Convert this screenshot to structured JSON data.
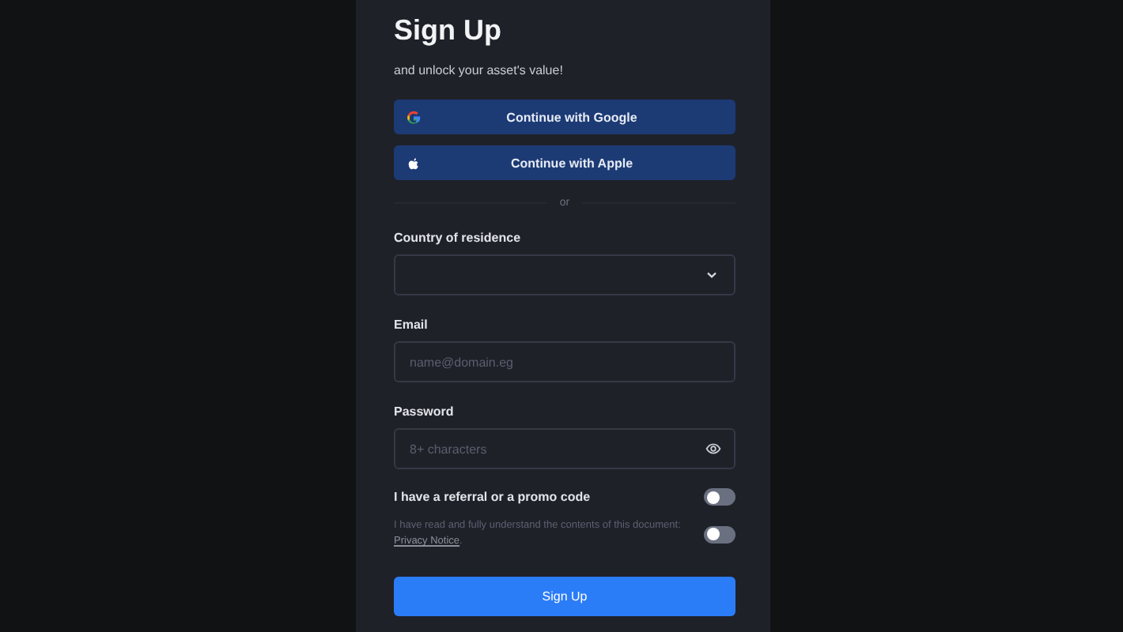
{
  "title": "Sign Up",
  "subtitle": "and unlock your asset's value!",
  "social_buttons": [
    {
      "kind": "google",
      "label": "Continue with Google"
    },
    {
      "kind": "apple",
      "label": "Continue with Apple"
    }
  ],
  "divider": "or",
  "fields": [
    {
      "kind": "select",
      "label": "Country of residence"
    },
    {
      "kind": "email",
      "label": "Email",
      "placeholder": "name@domain.eg"
    },
    {
      "kind": "password",
      "label": "Password",
      "placeholder": "8+ characters"
    }
  ],
  "toggles": [
    {
      "kind": "promo",
      "label": "I have a referral or a promo code",
      "on": false
    },
    {
      "kind": "consent",
      "label": "I have read and fully understand the contents of this document:",
      "link": "Privacy Notice",
      "suffix": ".",
      "on": false
    }
  ],
  "submit": "Sign Up"
}
